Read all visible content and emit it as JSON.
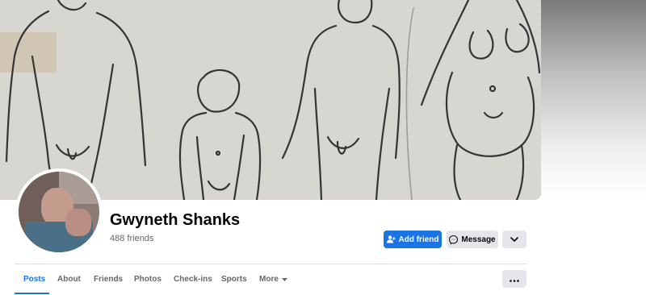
{
  "profile": {
    "name": "Gwyneth Shanks",
    "friends_count": "488 friends"
  },
  "actions": {
    "add_friend_label": "Add friend",
    "message_label": "Message"
  },
  "tabs": [
    {
      "label": "Posts"
    },
    {
      "label": "About"
    },
    {
      "label": "Friends"
    },
    {
      "label": "Photos"
    },
    {
      "label": "Check-ins"
    },
    {
      "label": "Sports"
    },
    {
      "label": "More"
    }
  ],
  "icons": {
    "add_friend": "person-plus-icon",
    "message": "messenger-icon",
    "more": "chevron-down-icon",
    "more_tab": "caret-down-icon",
    "overflow": "ellipsis-icon"
  },
  "colors": {
    "accent": "#1b74e4",
    "button_gray": "#e4e6eb",
    "text_primary": "#050505",
    "text_secondary": "#65676b"
  }
}
